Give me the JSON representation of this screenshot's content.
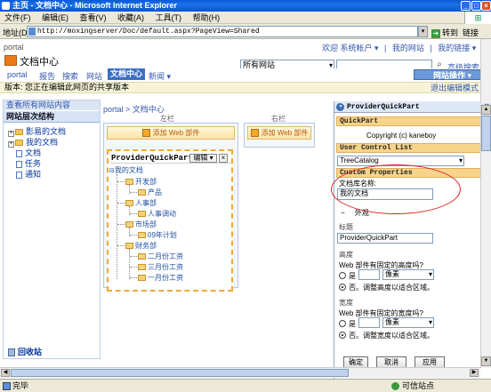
{
  "window": {
    "title": "主页 - 文档中心 - Microsoft Internet Explorer",
    "controls": [
      "_",
      "□",
      "×"
    ]
  },
  "menu": [
    "文件(F)",
    "编辑(E)",
    "查看(V)",
    "收藏(A)",
    "工具(T)",
    "帮助(H)"
  ],
  "address": {
    "label": "地址(D)",
    "url": "http://moxingserver/Doc/default.aspx?PageView=Shared",
    "go_label": "转到",
    "links_label": "链接"
  },
  "site": {
    "breadcrumb": "portal",
    "top_links": [
      "欢迎 系统帐户 ▾",
      "|",
      "我的网站",
      "|",
      "我的链接 ▾"
    ],
    "title": "文档中心",
    "search_scope": "所有网站",
    "search_placeholder": "",
    "search_go_icon": "search-icon",
    "advanced_search": "高级搜索",
    "nav_tabs": [
      "portal",
      "报告",
      "搜索",
      "网站",
      "文档中心",
      "新闻 ▾"
    ],
    "active_tab_index": 4,
    "site_actions": "网站操作 ▾",
    "version_bar": "版本: 您正在编辑此网页的共享版本",
    "exit_edit": "退出编辑模式 ✕"
  },
  "quick_launch": {
    "view_all": "查看所有网站内容",
    "tree_title": "网站层次结构",
    "items": [
      {
        "label": "影易的文档",
        "type": "folder",
        "expand": "+"
      },
      {
        "label": "我的文档",
        "type": "folder",
        "expand": "+"
      },
      {
        "label": "文档",
        "type": "doc",
        "expand": ""
      },
      {
        "label": "任务",
        "type": "doc",
        "expand": ""
      },
      {
        "label": "通知",
        "type": "doc",
        "expand": ""
      }
    ],
    "recycle_bin": "回收站"
  },
  "main": {
    "breadcrumb": "portal > 文档中心",
    "zones": {
      "left_label": "左栏",
      "right_label": "右栏",
      "add_part": "添加 Web 部件"
    },
    "webpart": {
      "title": "ProviderQuickPart",
      "edit_label": "编辑 ▾",
      "close_label": "×",
      "tree": [
        {
          "label": "我的文档",
          "level": 0
        },
        {
          "label": "开发部",
          "level": 1
        },
        {
          "label": "产品",
          "level": 2
        },
        {
          "label": "人事部",
          "level": 1
        },
        {
          "label": "人事调动",
          "level": 2
        },
        {
          "label": "市场部",
          "level": 1
        },
        {
          "label": "09年计划",
          "level": 2
        },
        {
          "label": "财务部",
          "level": 1
        },
        {
          "label": "二月份工资",
          "level": 2
        },
        {
          "label": "三月份工资",
          "level": 2
        },
        {
          "label": "一月份工资",
          "level": 2
        }
      ]
    }
  },
  "tool_pane": {
    "title": "ProviderQuickPart",
    "close": "×",
    "sections": {
      "quickpart": "QuickPart",
      "user_control_list": "User Control List",
      "custom_properties": "Custom Properties"
    },
    "copyright": "Copyright (c) kaneboy",
    "user_control_value": "TreeCatalog",
    "doc_lib_label": "文档库名称:",
    "doc_lib_value": "我的文档",
    "appearance": "外观",
    "appearance_toggle": "−",
    "title_label": "标题",
    "title_value": "ProviderQuickPart",
    "height_label": "高度",
    "height_question": "Web 部件有固定的高度吗?",
    "width_label": "宽度",
    "width_question": "Web 部件有固定的宽度吗?",
    "yes_label": "是",
    "unit_label": "像素",
    "no_height": "否。调整高度以适合区域。",
    "no_width": "否。调整宽度以适合区域。",
    "buttons": {
      "ok": "确定",
      "cancel": "取消",
      "apply": "应用"
    }
  },
  "status": {
    "text": "完毕",
    "zone": "可信站点"
  }
}
